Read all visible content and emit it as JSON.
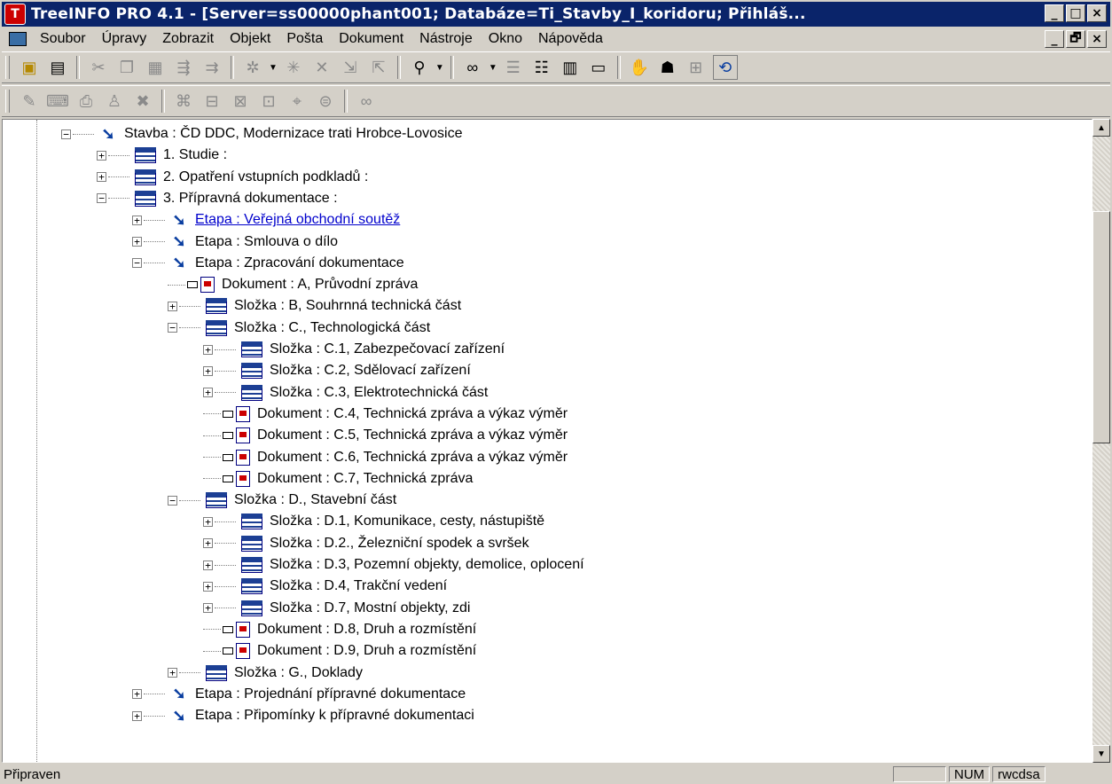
{
  "window": {
    "title": "TreeINFO PRO 4.1 - [Server=ss00000phant001; Databáze=Ti_Stavby_I_koridoru; Přihláš...",
    "app_icon_letter": "T",
    "controls": [
      "_",
      "□",
      "×"
    ],
    "mdi_controls": [
      "_",
      "🗗",
      "×"
    ]
  },
  "menu": {
    "items": [
      "Soubor",
      "Úpravy",
      "Zobrazit",
      "Objekt",
      "Pošta",
      "Dokument",
      "Nástroje",
      "Okno",
      "Nápověda"
    ]
  },
  "toolbar1": {
    "icons": [
      "new-folder-icon",
      "properties-icon",
      "cut-icon",
      "copy-icon",
      "paste-icon",
      "move-icon",
      "link-icon",
      "sparkle-icon",
      "sparkle-alt-icon",
      "delete-icon",
      "import-icon",
      "export-icon",
      "find-icon",
      "view-icon",
      "list-icon",
      "details-icon",
      "grid-icon",
      "window-icon",
      "handshake-icon",
      "users-icon",
      "network-icon",
      "refresh-icon"
    ]
  },
  "tree": {
    "nodes": [
      {
        "label": "Stavba : ČD DDC, Modernizace trati Hrobce-Lovosice",
        "type": "stage",
        "expand": "−"
      },
      {
        "label": "1. Studie :",
        "type": "folder",
        "expand": "+"
      },
      {
        "label": "2. Opatření vstupních podkladů :",
        "type": "folder",
        "expand": "+"
      },
      {
        "label": "3. Přípravná dokumentace :",
        "type": "folder",
        "expand": "−"
      },
      {
        "label": "Etapa : Veřejná obchodní soutěž",
        "type": "stage",
        "expand": "+",
        "link": true
      },
      {
        "label": "Etapa : Smlouva o dílo",
        "type": "stage",
        "expand": "+"
      },
      {
        "label": "Etapa : Zpracování dokumentace",
        "type": "stage",
        "expand": "−"
      },
      {
        "label": "Dokument : A, Průvodní zpráva",
        "type": "doc"
      },
      {
        "label": "Složka : B, Souhrnná technická část",
        "type": "folder",
        "expand": "+"
      },
      {
        "label": "Složka : C., Technologická část",
        "type": "folder",
        "expand": "−"
      },
      {
        "label": "Složka : C.1, Zabezpečovací zařízení",
        "type": "folder",
        "expand": "+"
      },
      {
        "label": "Složka : C.2, Sdělovací zařízení",
        "type": "folder",
        "expand": "+"
      },
      {
        "label": "Složka : C.3, Elektrotechnická část",
        "type": "folder",
        "expand": "+"
      },
      {
        "label": "Dokument : C.4, Technická zpráva a výkaz výměr",
        "type": "doc"
      },
      {
        "label": "Dokument : C.5, Technická zpráva a výkaz výměr",
        "type": "doc"
      },
      {
        "label": "Dokument : C.6, Technická zpráva a výkaz výměr",
        "type": "doc"
      },
      {
        "label": "Dokument : C.7, Technická zpráva",
        "type": "doc"
      },
      {
        "label": "Složka : D., Stavební část",
        "type": "folder",
        "expand": "−"
      },
      {
        "label": "Složka : D.1, Komunikace, cesty, nástupiště",
        "type": "folder",
        "expand": "+"
      },
      {
        "label": "Složka : D.2., Železniční spodek a svršek",
        "type": "folder",
        "expand": "+"
      },
      {
        "label": "Složka : D.3, Pozemní objekty, demolice, oplocení",
        "type": "folder",
        "expand": "+"
      },
      {
        "label": "Složka : D.4, Trakční vedení",
        "type": "folder",
        "expand": "+"
      },
      {
        "label": "Složka : D.7, Mostní objekty, zdi",
        "type": "folder",
        "expand": "+"
      },
      {
        "label": "Dokument : D.8, Druh a rozmístění",
        "type": "doc"
      },
      {
        "label": "Dokument : D.9, Druh a rozmístění",
        "type": "doc"
      },
      {
        "label": "Složka : G., Doklady",
        "type": "folder",
        "expand": "+"
      },
      {
        "label": "Etapa : Projednání přípravné dokumentace",
        "type": "stage",
        "expand": "+"
      },
      {
        "label": "Etapa : Připomínky k přípravné dokumentaci",
        "type": "stage",
        "expand": "+"
      }
    ]
  },
  "status": {
    "main": "Připraven",
    "panel_empty": "",
    "num": "NUM",
    "rights": "rwcdsa"
  }
}
